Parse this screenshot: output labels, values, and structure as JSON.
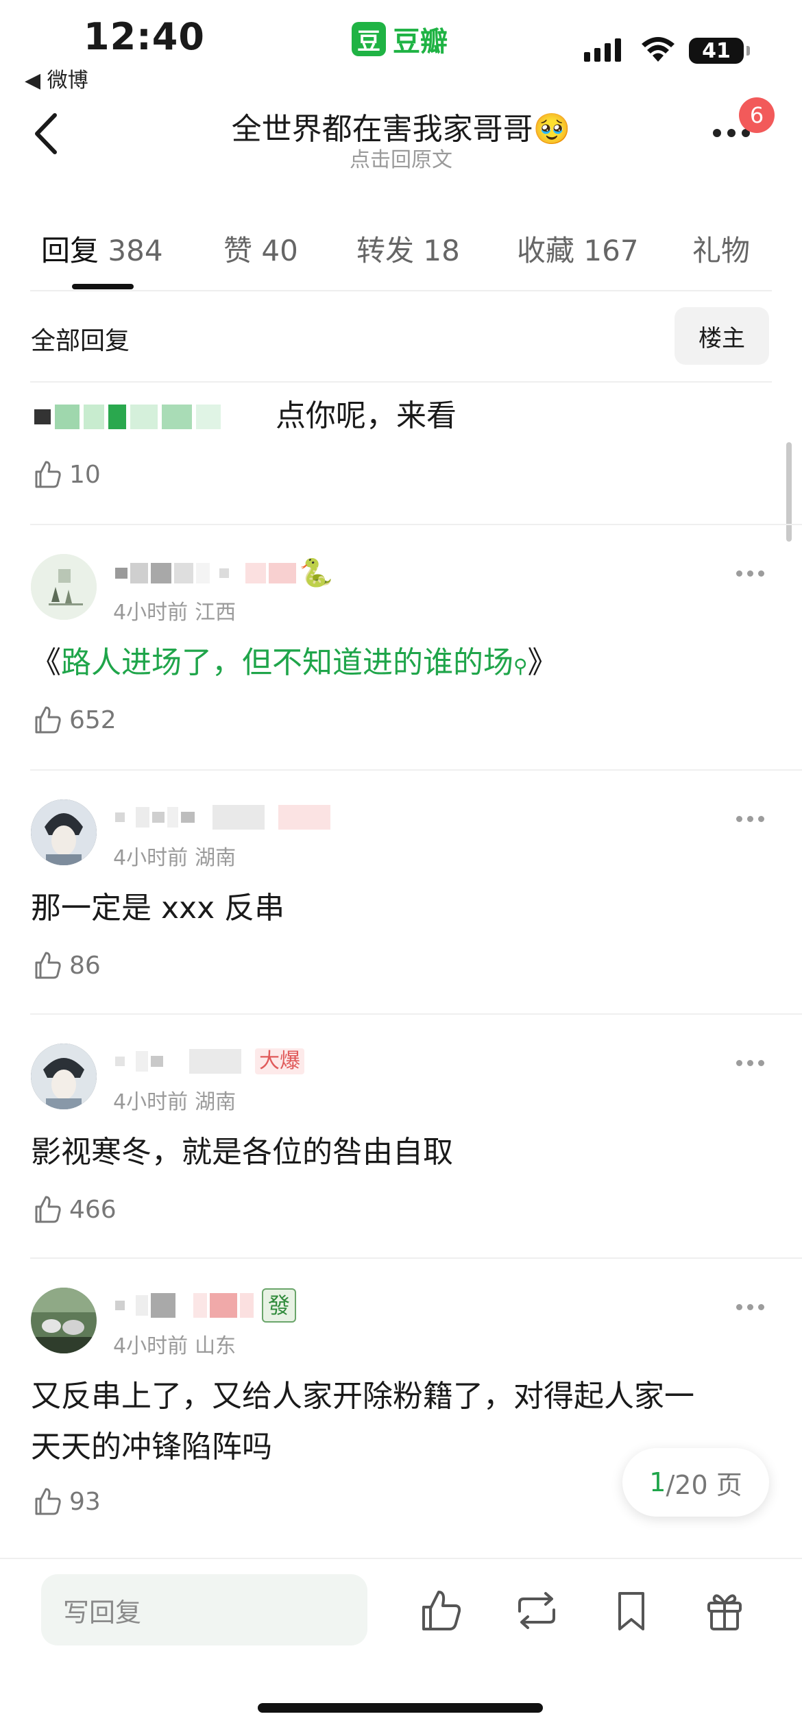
{
  "status_bar": {
    "time": "12:40",
    "back_app": "◀ 微博",
    "app_logo": "豆",
    "app_name": "豆瓣",
    "battery": "41"
  },
  "nav": {
    "title": "全世界都在害我家哥哥🥹",
    "subtitle": "点击回原文",
    "notification_count": "6"
  },
  "tabs": [
    {
      "label": "回复",
      "count": "384"
    },
    {
      "label": "赞",
      "count": "40"
    },
    {
      "label": "转发",
      "count": "18"
    },
    {
      "label": "收藏",
      "count": "167"
    },
    {
      "label": "礼物",
      "count": ""
    }
  ],
  "filter": {
    "label": "全部回复",
    "op_button": "楼主"
  },
  "comments": [
    {
      "text": "点你呢，来看",
      "likes": "10"
    },
    {
      "time": "4小时前",
      "location": "江西",
      "text_prefix": "《",
      "text_link": "路人进场了，但不知道进的谁的场",
      "text_suffix": "》",
      "likes": "652"
    },
    {
      "time": "4小时前",
      "location": "湖南",
      "text": "那一定是 xxx 反串",
      "likes": "86"
    },
    {
      "time": "4小时前",
      "location": "湖南",
      "badge": "大爆",
      "text": "影视寒冬，就是各位的咎由自取",
      "likes": "466"
    },
    {
      "time": "4小时前",
      "location": "山东",
      "badge_icon": "發",
      "text_line1": "又反串上了，又给人家开除粉籍了，对得起人家一",
      "text_line2": "天天的冲锋陷阵吗",
      "likes": "93"
    }
  ],
  "pagination": {
    "current": "1",
    "total": "/20 页"
  },
  "bottom_bar": {
    "reply_placeholder": "写回复",
    "icons": [
      "like-icon",
      "repost-icon",
      "bookmark-icon",
      "gift-icon"
    ]
  },
  "colors": {
    "accent_green": "#1fa54a",
    "badge_red": "#f25a5a"
  }
}
